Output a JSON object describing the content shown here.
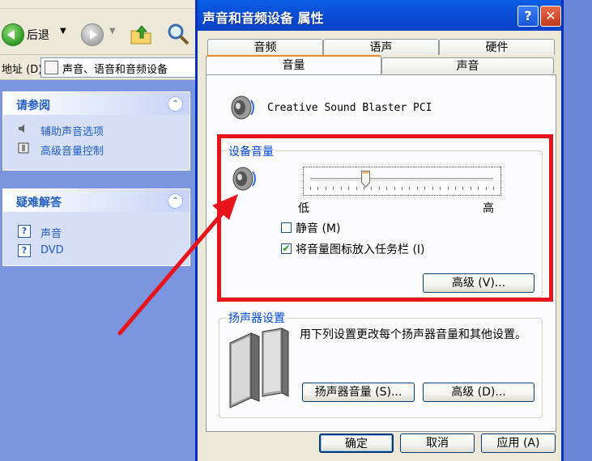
{
  "explorer": {
    "toolbar": {
      "back_label": "后退"
    },
    "address": {
      "label": "地址 (D)",
      "value": "声音、语音和音频设备"
    },
    "see_also": {
      "title": "请参阅",
      "items": [
        {
          "label": "辅助声音选项"
        },
        {
          "label": "高级音量控制"
        }
      ]
    },
    "troubleshoot": {
      "title": "疑难解答",
      "items": [
        {
          "label": "声音"
        },
        {
          "label": "DVD"
        }
      ]
    }
  },
  "dialog": {
    "title": "声音和音频设备 属性",
    "help_button": "?",
    "close_button": "✕",
    "tabs_row1": [
      "音频",
      "语声",
      "硬件"
    ],
    "tabs_row2": [
      "音量",
      "声音"
    ],
    "active_tab": "音量",
    "device_name": "Creative Sound Blaster PCI",
    "device_volume": {
      "group_label": "设备音量",
      "slider_low": "低",
      "slider_high": "高",
      "slider_value_fraction": 0.3,
      "mute_label": "静音 (M)",
      "mute_checked": false,
      "tray_label": "将音量图标放入任务栏 (I)",
      "tray_checked": true,
      "advanced_button": "高级 (V)..."
    },
    "speaker_settings": {
      "group_label": "扬声器设置",
      "description": "用下列设置更改每个扬声器音量和其他设置。",
      "volume_button": "扬声器音量 (S)...",
      "advanced_button": "高级 (D)..."
    },
    "buttons": {
      "ok": "确定",
      "cancel": "取消",
      "apply": "应用 (A)"
    }
  },
  "colors": {
    "highlight_box": "#e8141b",
    "arrow": "#e8141b",
    "titlebar": "#0a50d6"
  }
}
